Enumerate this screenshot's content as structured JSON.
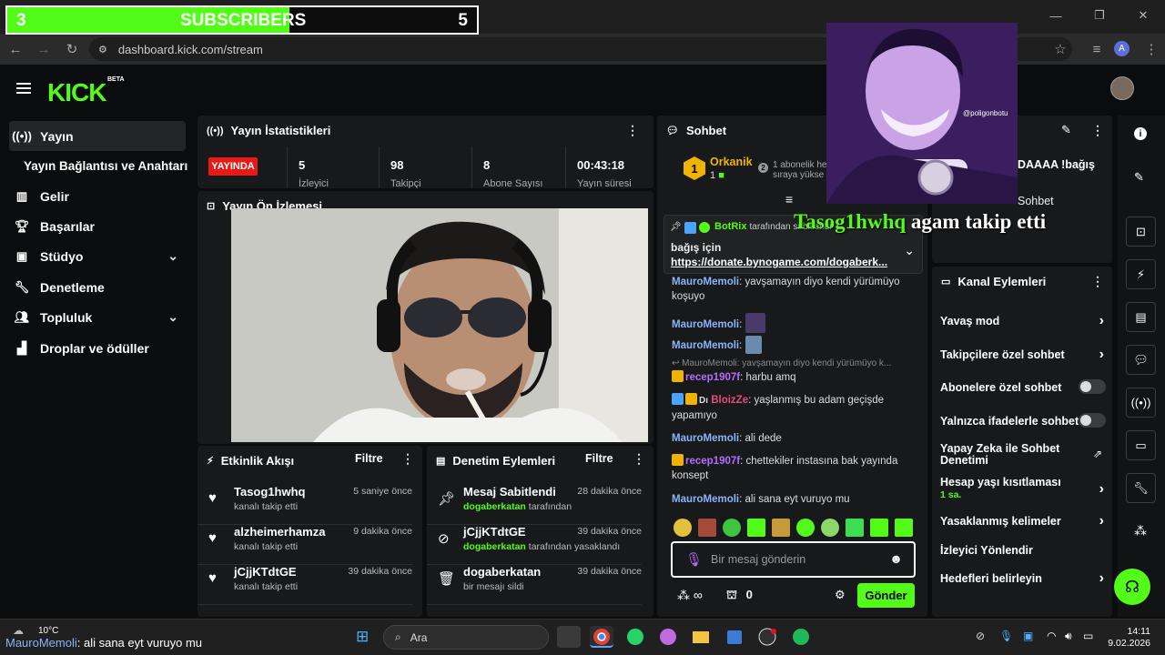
{
  "overlay": {
    "sub_count": "3",
    "sub_label": "SUBSCRIBERS",
    "sub_goal": "5",
    "sub_progress": 0.6
  },
  "browser": {
    "url": "dashboard.kick.com/stream",
    "profile_initial": "A"
  },
  "header": {
    "logo": "KICK",
    "beta": "BETA"
  },
  "sidebar": {
    "items": [
      {
        "label": "Yayın",
        "icon": "broadcast-icon"
      },
      {
        "label": "Yayın Bağlantısı ve Anahtarı",
        "icon": ""
      },
      {
        "label": "Gelir",
        "icon": "revenue-icon"
      },
      {
        "label": "Başarılar",
        "icon": "trophy-icon"
      },
      {
        "label": "Stüdyo",
        "icon": "studio-icon"
      },
      {
        "label": "Denetleme",
        "icon": "wrench-icon"
      },
      {
        "label": "Topluluk",
        "icon": "community-icon"
      },
      {
        "label": "Droplar ve ödüller",
        "icon": "drops-icon"
      }
    ]
  },
  "stats": {
    "title": "Yayın İstatistikleri",
    "live": "YAYINDA",
    "values": [
      {
        "num": "5",
        "label": "İzleyici"
      },
      {
        "num": "98",
        "label": "Takipçi"
      },
      {
        "num": "8",
        "label": "Abone Sayısı"
      },
      {
        "num": "00:43:18",
        "label": "Yayın süresi"
      }
    ]
  },
  "preview": {
    "title": "Yayın Ön İzlemesi"
  },
  "activity": {
    "title": "Etkinlik Akışı",
    "filter": "Filtre",
    "rows": [
      {
        "name": "Tasog1hwhq",
        "sub": "kanalı takip etti",
        "time": "5 saniye önce"
      },
      {
        "name": "alzheimerhamza",
        "sub": "kanalı takip etti",
        "time": "9 dakika önce"
      },
      {
        "name": "jCjjKTdtGE",
        "sub": "kanalı takip etti",
        "time": "39 dakika önce"
      }
    ]
  },
  "moderation": {
    "title": "Denetim Eylemleri",
    "filter": "Filtre",
    "rows": [
      {
        "title": "Mesaj Sabitlendi",
        "by": "dogaberkatan",
        "sub": "tarafından",
        "time": "28 dakika önce"
      },
      {
        "title": "jCjjKTdtGE",
        "by": "dogaberkatan",
        "sub": "tarafından yasaklandı",
        "time": "39 dakika önce"
      },
      {
        "title": "dogaberkatan",
        "by": "",
        "sub": "bir mesajı sildi",
        "time": "39 dakika önce"
      }
    ]
  },
  "chat": {
    "title": "Sohbet",
    "top_user": "Orkanik",
    "top_user_count": "1",
    "top_rank": "1",
    "top_rank2": "2",
    "top_note_1": "1 abonelik he",
    "top_note_2": "sıraya yükse",
    "pinned_by": "BotRix",
    "pinned_suffix": "tarafından sabitlendi",
    "pinned_text": "bağış için",
    "pinned_link": "https://donate.bynogame.com/dogaberk...",
    "messages": [
      {
        "user": "MauroMemoli",
        "text": "yavşamayın diyo kendi yürümüyo koşuyo"
      },
      {
        "user": "MauroMemoli",
        "text": ""
      },
      {
        "user": "MauroMemoli",
        "text": ""
      },
      {
        "reply": "MauroMemoli: yavşamayın diyo kendi yürümüyo k..."
      },
      {
        "user": "recep1907f",
        "text": "harbu amq"
      },
      {
        "user": "BloizZe",
        "prefix": "Dı",
        "text": "yaşlanmış bu adam geçişde yapamıyo"
      },
      {
        "user": "MauroMemoli",
        "text": "ali dede"
      },
      {
        "user": "recep1907f",
        "text": "chettekiler instasına bak yayında konsept"
      },
      {
        "user": "MauroMemoli",
        "text": "ali sana eyt vuruyo mu"
      }
    ],
    "placeholder": "Bir mesaj gönderin",
    "points": "∞",
    "gifts": "0",
    "send": "Gönder"
  },
  "actions": {
    "title": "Kanal Eylemleri",
    "top_text": "DAAAA !bağış",
    "top_text2": "Sohbet",
    "items": [
      {
        "label": "Yavaş mod",
        "kind": "arrow"
      },
      {
        "label": "Takipçilere özel sohbet",
        "kind": "arrow"
      },
      {
        "label": "Abonelere özel sohbet",
        "kind": "toggle"
      },
      {
        "label": "Yalnızca ifadelerle sohbet",
        "kind": "toggle"
      },
      {
        "label": "Yapay Zeka ile Sohbet Denetimi",
        "kind": "external"
      },
      {
        "label": "Hesap yaşı kısıtlaması",
        "sub": "1 sa.",
        "kind": "arrow"
      },
      {
        "label": "Yasaklanmış kelimeler",
        "kind": "arrow"
      },
      {
        "label": "İzleyici Yönlendir",
        "kind": "none"
      },
      {
        "label": "Hedefleri belirleyin",
        "kind": "arrow"
      }
    ]
  },
  "webcam": {
    "watermark": "@poligonbotu"
  },
  "alert": {
    "name": "Tasog1hwhq",
    "text": "agam takip etti"
  },
  "taskbar": {
    "temp": "10°C",
    "ticker_user": "MauroMemoli",
    "ticker_text": ": ali sana eyt vuruyo mu",
    "search": "Ara",
    "time": "14:11",
    "date": "9.02.2026"
  },
  "colors": {
    "accent": "#53fc18",
    "live": "#e91916",
    "panel": "#18191b"
  }
}
